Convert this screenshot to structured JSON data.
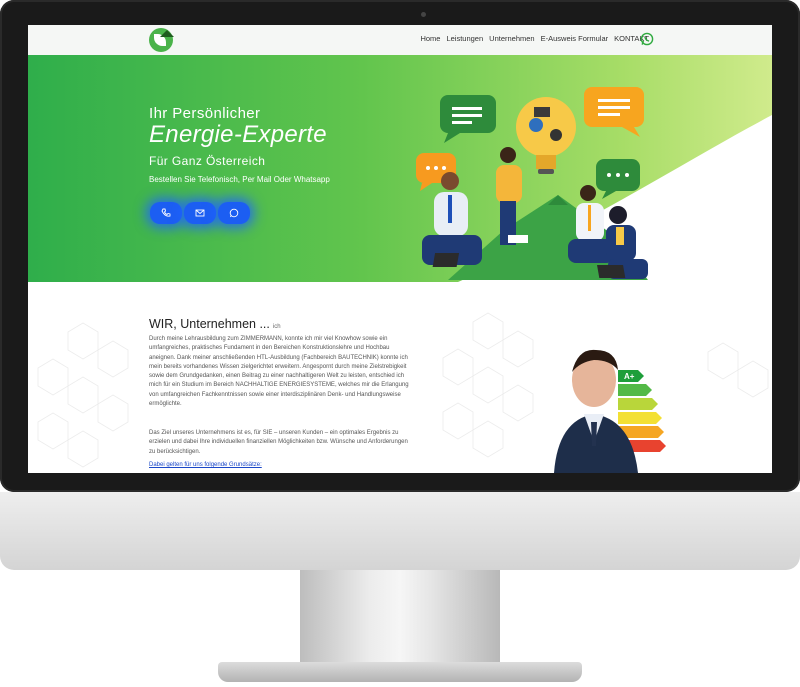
{
  "nav": {
    "items": [
      "Home",
      "Leistungen",
      "Unternehmen",
      "E-Ausweis Formular",
      "KONTAKT"
    ],
    "logo_icon": "energy-house-leaf-icon",
    "whatsapp_icon": "whatsapp-icon"
  },
  "hero": {
    "line1": "Ihr Persönlicher",
    "line2": "Energie-Experte",
    "line3": "Für Ganz Österreich",
    "line4": "Bestellen Sie Telefonisch, Per Mail Oder Whatsapp",
    "buttons": [
      {
        "icon": "phone-icon"
      },
      {
        "icon": "mail-icon"
      },
      {
        "icon": "whatsapp-icon"
      }
    ]
  },
  "about": {
    "title": "WIR, Unternehmen ...",
    "title_sup": "ich",
    "paragraph1": "Durch meine Lehrausbildung zum ZIMMERMANN, konnte ich mir viel Knowhow sowie ein umfangreiches, praktisches Fundament in den Bereichen Konstruktionslehre und Hochbau aneignen. Dank meiner anschließenden HTL-Ausbildung (Fachbereich BAUTECHNIK) konnte ich mein bereits vorhandenes Wissen zielgerichtet erweitern. Angespornt durch meine Zielstrebigkeit sowie dem Grundgedanken, einen Beitrag zu einer nachhaltigeren Welt zu leisten, entschied ich mich für ein Studium im Bereich NACHHALTIGE ENERGIESYSTEME, welches mir die Erlangung von umfangreichen Fachkenntnissen sowie einer interdisziplinären Denk- und Handlungsweise ermöglichte.",
    "paragraph2": "Das Ziel unseres Unternehmens ist es, für SIE – unseren Kunden – ein optimales Ergebnis zu erzielen und dabei Ihre individuellen finanziellen Möglichkeiten bzw. Wünsche und Anforderungen zu berücksichtigen.",
    "link": "Dabei gelten für uns folgende Grundsätze:",
    "energy_label_top": "A+"
  },
  "colors": {
    "brand_green": "#4ab34a",
    "cta_blue": "#1c5ef2",
    "link_blue": "#1a47c8"
  }
}
